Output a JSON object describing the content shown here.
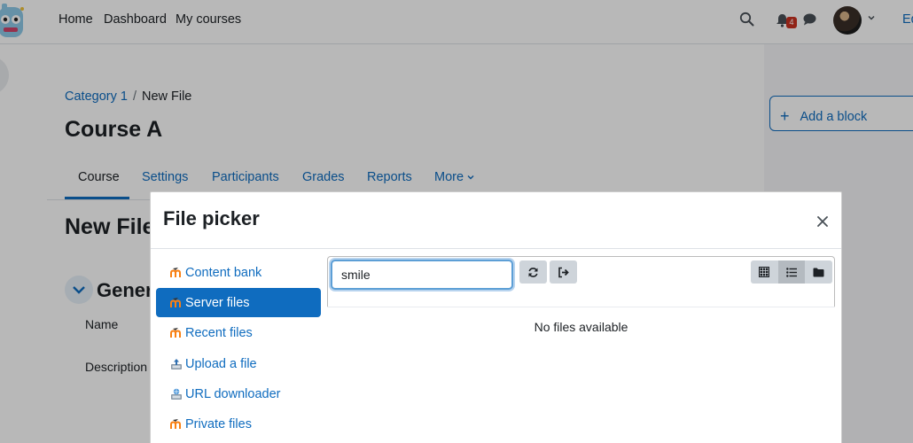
{
  "navbar": {
    "links": [
      "Home",
      "Dashboard",
      "My courses"
    ],
    "notification_count": "4",
    "edit_label": "Ed"
  },
  "page": {
    "breadcrumb": [
      "Category 1",
      "New File"
    ],
    "course_title": "Course A",
    "tabs": [
      "Course",
      "Settings",
      "Participants",
      "Grades",
      "Reports",
      "More"
    ],
    "heading": "New File",
    "section_title": "General",
    "form_labels": [
      "Name",
      "Description"
    ],
    "add_block_label": "Add a block"
  },
  "modal": {
    "title": "File picker",
    "repositories": [
      {
        "label": "Content bank",
        "icon": "moodle-icon"
      },
      {
        "label": "Server files",
        "icon": "moodle-icon",
        "active": true
      },
      {
        "label": "Recent files",
        "icon": "moodle-icon"
      },
      {
        "label": "Upload a file",
        "icon": "upload-icon"
      },
      {
        "label": "URL downloader",
        "icon": "url-download-icon"
      },
      {
        "label": "Private files",
        "icon": "moodle-icon"
      }
    ],
    "search_value": "smile",
    "empty_message": "No files available",
    "active_view": "list"
  },
  "colors": {
    "brand": "#0f6cbf",
    "moodle_orange": "#f98012",
    "badge": "#ca3120"
  }
}
